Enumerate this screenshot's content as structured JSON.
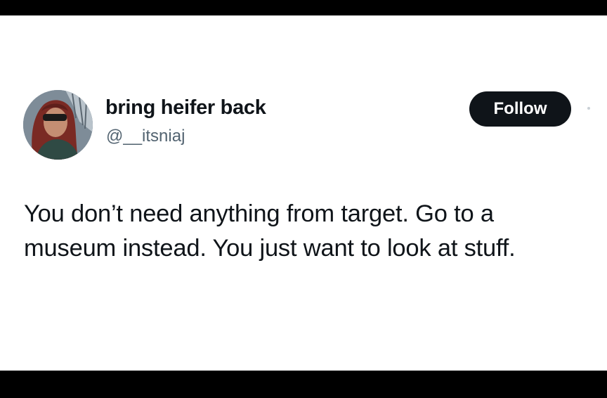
{
  "tweet": {
    "author": {
      "display_name": "bring heifer back",
      "handle": "@__itsniaj",
      "avatar_icon": "profile-photo"
    },
    "follow_label": "Follow",
    "text_lines": [
      "You don’t need anything from target. Go to a",
      "museum instead. You just want to look at stuff."
    ]
  },
  "colors": {
    "background_frame": "#000000",
    "card": "#ffffff",
    "text_primary": "#0f1419",
    "text_secondary": "#536471",
    "follow_button_bg": "#0f1419",
    "follow_button_text": "#ffffff"
  }
}
